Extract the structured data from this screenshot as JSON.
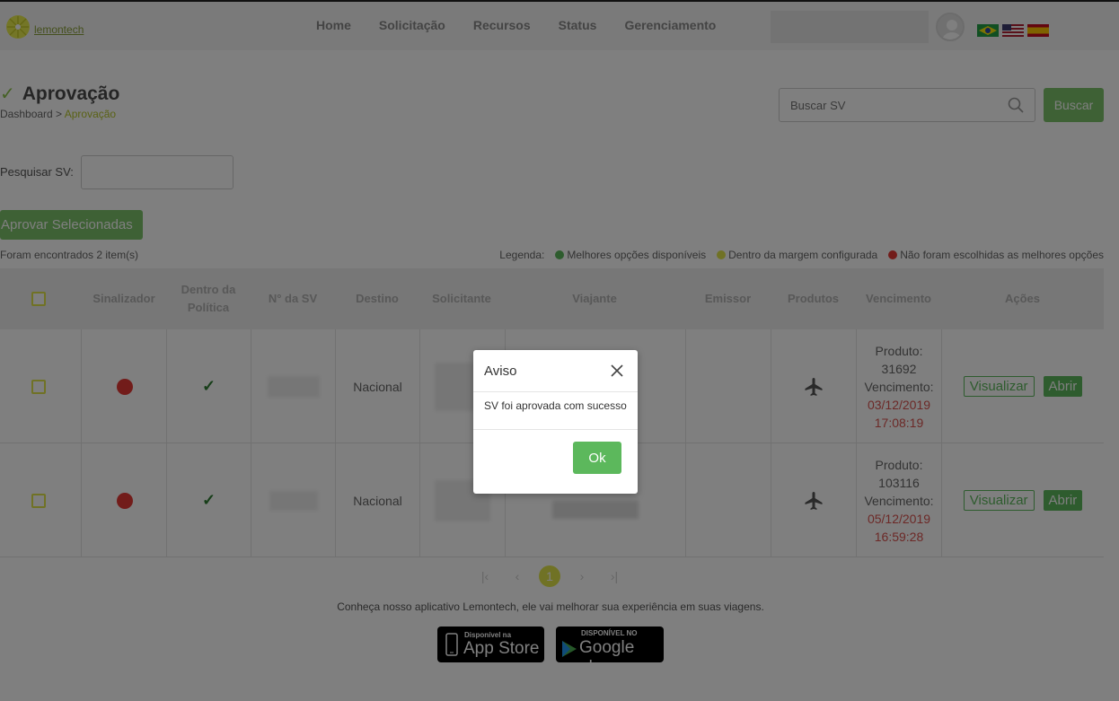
{
  "brand": {
    "name": "lemontech"
  },
  "nav": {
    "items": [
      "Home",
      "Solicitação",
      "Recursos",
      "Status",
      "Gerenciamento"
    ]
  },
  "page": {
    "title": "Aprovação",
    "breadcrumb": {
      "root": "Dashboard",
      "sep": " > ",
      "current": "Aprovação"
    }
  },
  "search": {
    "placeholder": "Buscar SV",
    "button": "Buscar"
  },
  "filter": {
    "label": "Pesquisar SV:"
  },
  "actions": {
    "approve_selected": "Aprovar Selecionadas"
  },
  "results": {
    "found_text": "Foram encontrados 2 item(s)"
  },
  "legend": {
    "label": "Legenda:",
    "items": [
      {
        "label": "Melhores opções disponíveis",
        "color": "#5cb85c"
      },
      {
        "label": "Dentro da margem configurada",
        "color": "#e1e54a"
      },
      {
        "label": "Não foram escolhidas as melhores opções",
        "color": "#e53935"
      }
    ]
  },
  "table": {
    "headers": [
      "Sinalizador",
      "Dentro da Política",
      "N° da SV",
      "Destino",
      "Solicitante",
      "Viajante",
      "Emissor",
      "Produtos",
      "Vencimento",
      "Ações"
    ],
    "rows": [
      {
        "destino": "Nacional",
        "produto_label": "Produto:",
        "produto": "31692",
        "venc_label": "Vencimento:",
        "venc_date": "03/12/2019",
        "venc_time": "17:08:19",
        "status_color": "#e53935"
      },
      {
        "destino": "Nacional",
        "produto_label": "Produto:",
        "produto": "103116",
        "venc_label": "Vencimento:",
        "venc_date": "05/12/2019",
        "venc_time": "16:59:28",
        "status_color": "#e53935"
      }
    ],
    "row_actions": {
      "view": "Visualizar",
      "open": "Abrir"
    }
  },
  "pagination": {
    "current": "1"
  },
  "footer": {
    "text": "Conheça nosso aplicativo Lemontech, ele vai melhorar sua experiência em suas viagens.",
    "app_store": {
      "small": "Disponível na",
      "big": "App Store"
    },
    "google_play": {
      "small": "DISPONÍVEL NO",
      "big": "Google play"
    }
  },
  "modal": {
    "title": "Aviso",
    "message": "SV foi aprovada com sucesso",
    "ok": "Ok"
  },
  "colors": {
    "accent": "#5cb85c",
    "brand": "#b5c42a",
    "danger": "#e53935"
  }
}
